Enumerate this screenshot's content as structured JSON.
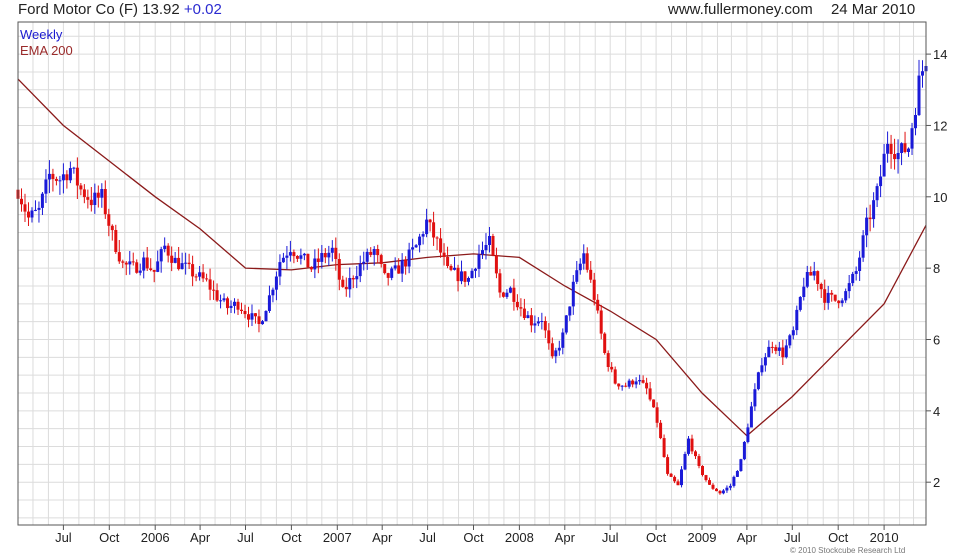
{
  "header": {
    "company": "Ford Motor Co (F)",
    "price": "13.92",
    "change": "+0.02",
    "site": "www.fullermoney.com",
    "date": "24 Mar 2010"
  },
  "legend": {
    "weekly": "Weekly",
    "ema": "EMA 200"
  },
  "copyright": "© 2010 Stockcube Research Ltd",
  "colors": {
    "up": "#1a1ad8",
    "down": "#e01010",
    "ema": "#8b1a1a",
    "grid": "#dcdcdc",
    "axis": "#555555"
  },
  "chart_data": {
    "type": "candlestick",
    "frequency": "weekly",
    "xlim": [
      "2005-04-01",
      "2010-03-26"
    ],
    "ylim": [
      0.8,
      14.9
    ],
    "y_ticks": [
      2,
      4,
      6,
      8,
      10,
      12,
      14
    ],
    "x_ticks": [
      {
        "label": "Jul",
        "date": "2005-07-01"
      },
      {
        "label": "Oct",
        "date": "2005-10-01"
      },
      {
        "label": "2006",
        "date": "2006-01-01"
      },
      {
        "label": "Apr",
        "date": "2006-04-01"
      },
      {
        "label": "Jul",
        "date": "2006-07-01"
      },
      {
        "label": "Oct",
        "date": "2006-10-01"
      },
      {
        "label": "2007",
        "date": "2007-01-01"
      },
      {
        "label": "Apr",
        "date": "2007-04-01"
      },
      {
        "label": "Jul",
        "date": "2007-07-01"
      },
      {
        "label": "Oct",
        "date": "2007-10-01"
      },
      {
        "label": "2008",
        "date": "2008-01-01"
      },
      {
        "label": "Apr",
        "date": "2008-04-01"
      },
      {
        "label": "Jul",
        "date": "2008-07-01"
      },
      {
        "label": "Oct",
        "date": "2008-10-01"
      },
      {
        "label": "2009",
        "date": "2009-01-01"
      },
      {
        "label": "Apr",
        "date": "2009-04-01"
      },
      {
        "label": "Jul",
        "date": "2009-07-01"
      },
      {
        "label": "Oct",
        "date": "2009-10-01"
      },
      {
        "label": "2010",
        "date": "2010-01-01"
      }
    ],
    "close_anchors": [
      [
        "2005-04-01",
        10.2
      ],
      [
        "2005-04-22",
        9.4
      ],
      [
        "2005-05-13",
        9.6
      ],
      [
        "2005-06-03",
        10.6
      ],
      [
        "2005-06-24",
        10.5
      ],
      [
        "2005-07-15",
        10.8
      ],
      [
        "2005-08-05",
        10.2
      ],
      [
        "2005-08-26",
        9.9
      ],
      [
        "2005-09-16",
        10.0
      ],
      [
        "2005-10-07",
        8.9
      ],
      [
        "2005-10-28",
        8.1
      ],
      [
        "2005-11-18",
        8.0
      ],
      [
        "2005-12-09",
        8.2
      ],
      [
        "2005-12-30",
        7.9
      ],
      [
        "2006-01-20",
        8.6
      ],
      [
        "2006-02-10",
        8.2
      ],
      [
        "2006-03-03",
        8.0
      ],
      [
        "2006-03-24",
        7.8
      ],
      [
        "2006-04-14",
        7.6
      ],
      [
        "2006-05-05",
        7.2
      ],
      [
        "2006-05-26",
        6.9
      ],
      [
        "2006-06-16",
        7.0
      ],
      [
        "2006-07-07",
        6.7
      ],
      [
        "2006-07-28",
        6.4
      ],
      [
        "2006-08-18",
        7.2
      ],
      [
        "2006-09-08",
        8.2
      ],
      [
        "2006-09-29",
        8.6
      ],
      [
        "2006-10-20",
        8.3
      ],
      [
        "2006-11-10",
        8.0
      ],
      [
        "2006-12-01",
        8.3
      ],
      [
        "2006-12-22",
        8.5
      ],
      [
        "2007-01-12",
        7.3
      ],
      [
        "2007-02-02",
        7.8
      ],
      [
        "2007-02-23",
        8.2
      ],
      [
        "2007-03-16",
        8.5
      ],
      [
        "2007-04-06",
        7.7
      ],
      [
        "2007-04-27",
        7.9
      ],
      [
        "2007-05-18",
        8.2
      ],
      [
        "2007-06-08",
        8.6
      ],
      [
        "2007-06-29",
        9.3
      ],
      [
        "2007-07-20",
        8.7
      ],
      [
        "2007-08-10",
        7.9
      ],
      [
        "2007-08-31",
        7.8
      ],
      [
        "2007-09-21",
        7.7
      ],
      [
        "2007-10-12",
        8.4
      ],
      [
        "2007-11-02",
        8.7
      ],
      [
        "2007-11-23",
        7.3
      ],
      [
        "2007-12-14",
        7.4
      ],
      [
        "2008-01-04",
        6.9
      ],
      [
        "2008-01-25",
        6.5
      ],
      [
        "2008-02-15",
        6.6
      ],
      [
        "2008-03-07",
        5.4
      ],
      [
        "2008-03-28",
        6.1
      ],
      [
        "2008-04-18",
        7.5
      ],
      [
        "2008-05-09",
        8.4
      ],
      [
        "2008-05-30",
        7.2
      ],
      [
        "2008-06-20",
        5.6
      ],
      [
        "2008-07-11",
        4.8
      ],
      [
        "2008-08-01",
        4.7
      ],
      [
        "2008-08-22",
        4.9
      ],
      [
        "2008-09-12",
        4.6
      ],
      [
        "2008-10-03",
        3.7
      ],
      [
        "2008-10-24",
        2.2
      ],
      [
        "2008-11-14",
        1.9
      ],
      [
        "2008-12-05",
        3.2
      ],
      [
        "2008-12-26",
        2.4
      ],
      [
        "2009-01-16",
        1.9
      ],
      [
        "2009-02-06",
        1.7
      ],
      [
        "2009-02-27",
        1.9
      ],
      [
        "2009-03-20",
        2.6
      ],
      [
        "2009-04-10",
        4.1
      ],
      [
        "2009-05-01",
        5.4
      ],
      [
        "2009-05-22",
        5.9
      ],
      [
        "2009-06-12",
        5.6
      ],
      [
        "2009-07-03",
        6.2
      ],
      [
        "2009-07-24",
        7.6
      ],
      [
        "2009-08-14",
        7.9
      ],
      [
        "2009-09-04",
        7.2
      ],
      [
        "2009-09-25",
        7.1
      ],
      [
        "2009-10-16",
        7.3
      ],
      [
        "2009-11-06",
        7.9
      ],
      [
        "2009-11-27",
        9.2
      ],
      [
        "2009-12-18",
        10.1
      ],
      [
        "2010-01-08",
        11.6
      ],
      [
        "2010-01-29",
        11.2
      ],
      [
        "2010-02-19",
        11.4
      ],
      [
        "2010-03-12",
        13.2
      ],
      [
        "2010-03-26",
        13.92
      ]
    ],
    "ema200": [
      [
        "2005-04-01",
        13.3
      ],
      [
        "2005-07-01",
        12.0
      ],
      [
        "2005-10-01",
        11.0
      ],
      [
        "2006-01-01",
        10.0
      ],
      [
        "2006-04-01",
        9.1
      ],
      [
        "2006-07-01",
        8.0
      ],
      [
        "2006-10-01",
        7.95
      ],
      [
        "2007-01-01",
        8.1
      ],
      [
        "2007-04-01",
        8.15
      ],
      [
        "2007-07-01",
        8.3
      ],
      [
        "2007-10-01",
        8.4
      ],
      [
        "2008-01-01",
        8.3
      ],
      [
        "2008-04-01",
        7.5
      ],
      [
        "2008-07-01",
        6.8
      ],
      [
        "2008-10-01",
        6.0
      ],
      [
        "2009-01-01",
        4.5
      ],
      [
        "2009-04-01",
        3.3
      ],
      [
        "2009-07-01",
        4.4
      ],
      [
        "2009-10-01",
        5.7
      ],
      [
        "2010-01-01",
        7.0
      ],
      [
        "2010-03-26",
        9.2
      ]
    ]
  }
}
